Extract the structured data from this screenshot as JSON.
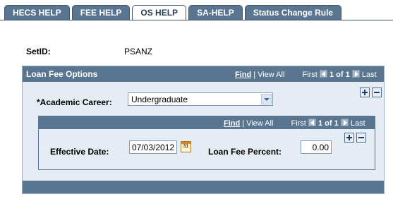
{
  "tabs": [
    "HECS HELP",
    "FEE HELP",
    "OS HELP",
    "SA-HELP",
    "Status Change Rule"
  ],
  "active_tab": "OS HELP",
  "setid": {
    "label": "SetID:",
    "value": "PSANZ"
  },
  "loan_fee_options": {
    "title": "Loan Fee Options",
    "nav": {
      "find": "Find",
      "separator": "|",
      "view_all": "View All",
      "first": "First",
      "count": "1 of 1",
      "last": "Last"
    },
    "academic_career": {
      "label": "*Academic Career:",
      "value": "Undergraduate"
    },
    "effective_dated": {
      "nav": {
        "find": "Find",
        "separator": "|",
        "view_all": "View All",
        "first": "First",
        "count": "1 of 1",
        "last": "Last"
      },
      "effective_date": {
        "label": "Effective Date:",
        "value": "07/03/2012",
        "calendar_icon_text": "31"
      },
      "loan_fee_percent": {
        "label": "Loan Fee Percent:",
        "value": "0.00"
      }
    }
  },
  "icons": {
    "prev": "chevron-left-icon",
    "next": "chevron-right-icon",
    "add": "plus-icon",
    "delete": "minus-icon",
    "calendar": "calendar-icon",
    "dropdown": "chevron-down-icon"
  },
  "colors": {
    "header": "#5a7590",
    "group_bg": "#e6ecf4",
    "active_tab_text": "#2a3f57"
  }
}
